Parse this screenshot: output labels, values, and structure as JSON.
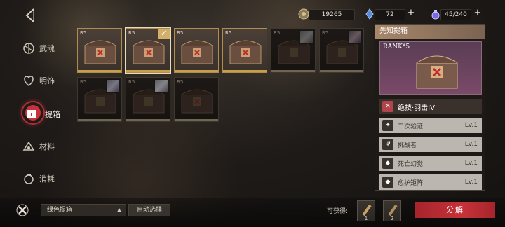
{
  "nav": {
    "items": [
      {
        "label": "武魂",
        "icon": "soul-icon"
      },
      {
        "label": "明饰",
        "icon": "heart-ornament-icon"
      },
      {
        "label": "提箱",
        "icon": "chest-icon"
      },
      {
        "label": "材料",
        "icon": "material-icon"
      },
      {
        "label": "消耗",
        "icon": "consumable-icon"
      }
    ],
    "active_index": 2
  },
  "currencies": [
    {
      "icon": "coin-icon",
      "value": "19265"
    },
    {
      "icon": "crystal-icon",
      "value": "72"
    },
    {
      "icon": "potion-icon",
      "value": "45/240"
    }
  ],
  "grid": {
    "items": [
      {
        "rarity": "R5",
        "style": "bright",
        "selected": false
      },
      {
        "rarity": "R5",
        "style": "bright",
        "selected": true
      },
      {
        "rarity": "R5",
        "style": "bright",
        "selected": false
      },
      {
        "rarity": "R5",
        "style": "bright",
        "selected": false
      },
      {
        "rarity": "R5",
        "style": "dark",
        "selected": false
      },
      {
        "rarity": "R5",
        "style": "dark",
        "selected": false
      },
      {
        "rarity": "R5",
        "style": "dark",
        "selected": false
      },
      {
        "rarity": "R5",
        "style": "dark",
        "selected": false
      },
      {
        "rarity": "R5",
        "style": "dark",
        "selected": false
      }
    ]
  },
  "panel": {
    "title": "先知提箱",
    "rank": "RANK*5",
    "main_skill": "绝技·羽击IV",
    "skills": [
      {
        "name": "二次验证",
        "level": "Lv.1"
      },
      {
        "name": "挑战者",
        "level": "Lv.1"
      },
      {
        "name": "死亡幻觉",
        "level": "Lv.1"
      },
      {
        "name": "愈护矩阵",
        "level": "Lv.1"
      }
    ]
  },
  "bottom": {
    "filter_value": "绿色提箱",
    "auto_select_label": "自动选择",
    "obtainable_label": "可获得:",
    "rewards": [
      {
        "icon": "material-scroll-icon",
        "quantity": "1"
      },
      {
        "icon": "material-scroll-icon",
        "quantity": "2"
      }
    ],
    "decompose_label": "分解"
  },
  "colors": {
    "accent_red": "#c6323a",
    "gold_border": "#b08d4e",
    "panel_title": "#a8876a"
  }
}
